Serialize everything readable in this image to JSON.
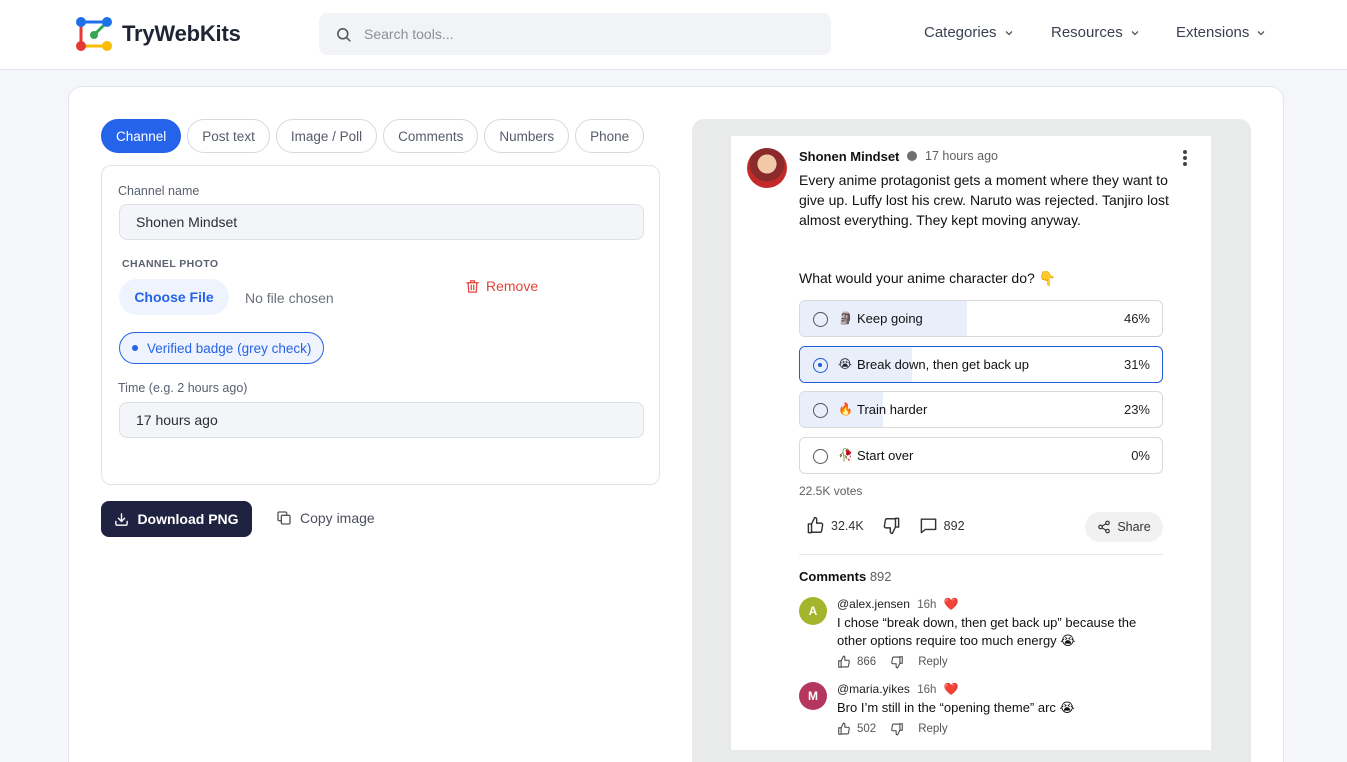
{
  "header": {
    "logo_text": "TryWebKits",
    "search_placeholder": "Search tools...",
    "nav": [
      "Categories",
      "Resources",
      "Extensions"
    ]
  },
  "tabs": [
    {
      "label": "Channel",
      "active": true
    },
    {
      "label": "Post text",
      "active": false
    },
    {
      "label": "Image / Poll",
      "active": false
    },
    {
      "label": "Comments",
      "active": false
    },
    {
      "label": "Numbers",
      "active": false
    },
    {
      "label": "Phone",
      "active": false
    }
  ],
  "form": {
    "channel_name_label": "Channel name",
    "channel_name_value": "Shonen Mindset",
    "channel_photo_label": "CHANNEL PHOTO",
    "choose_file_label": "Choose File",
    "no_file_text": "No file chosen",
    "remove_label": "Remove",
    "verified_label": "Verified badge (grey check)",
    "time_label": "Time (e.g. 2 hours ago)",
    "time_value": "17 hours ago"
  },
  "actions": {
    "download_label": "Download PNG",
    "copy_label": "Copy image"
  },
  "preview": {
    "channel_name": "Shonen Mindset",
    "time": "17 hours ago",
    "text": "Every anime protagonist gets a moment where they want to give up. Luffy lost his crew. Naruto was rejected. Tanjiro lost almost everything. They kept moving anyway.",
    "question": "What would your anime character do? 👇",
    "poll": [
      {
        "emoji": "🗿",
        "label": "Keep going",
        "percent": "46%",
        "fraction": 0.46,
        "selected": false
      },
      {
        "emoji": "😭",
        "label": "Break down, then get back up",
        "percent": "31%",
        "fraction": 0.31,
        "selected": true
      },
      {
        "emoji": "🔥",
        "label": "Train harder",
        "percent": "23%",
        "fraction": 0.23,
        "selected": false
      },
      {
        "emoji": "🥀",
        "label": "Start over",
        "percent": "0%",
        "fraction": 0.0,
        "selected": false
      }
    ],
    "votes": "22.5K votes",
    "likes": "32.4K",
    "comments_count": "892",
    "share_label": "Share",
    "comments_title": "Comments",
    "comments": [
      {
        "initial": "A",
        "color": "#a3b52c",
        "handle": "@alex.jensen",
        "time": "16h",
        "text": "I chose “break down, then get back up” because the other options require too much energy 😭",
        "likes": "866",
        "reply": "Reply"
      },
      {
        "initial": "M",
        "color": "#b5365f",
        "handle": "@maria.yikes",
        "time": "16h",
        "text": "Bro I’m still in the “opening theme” arc 😭",
        "likes": "502",
        "reply": "Reply"
      }
    ]
  },
  "colors": {
    "accent": "#2563eb",
    "dark_button": "#1f2240",
    "remove": "#e0453b",
    "poll_fill": "#e8eefa"
  }
}
